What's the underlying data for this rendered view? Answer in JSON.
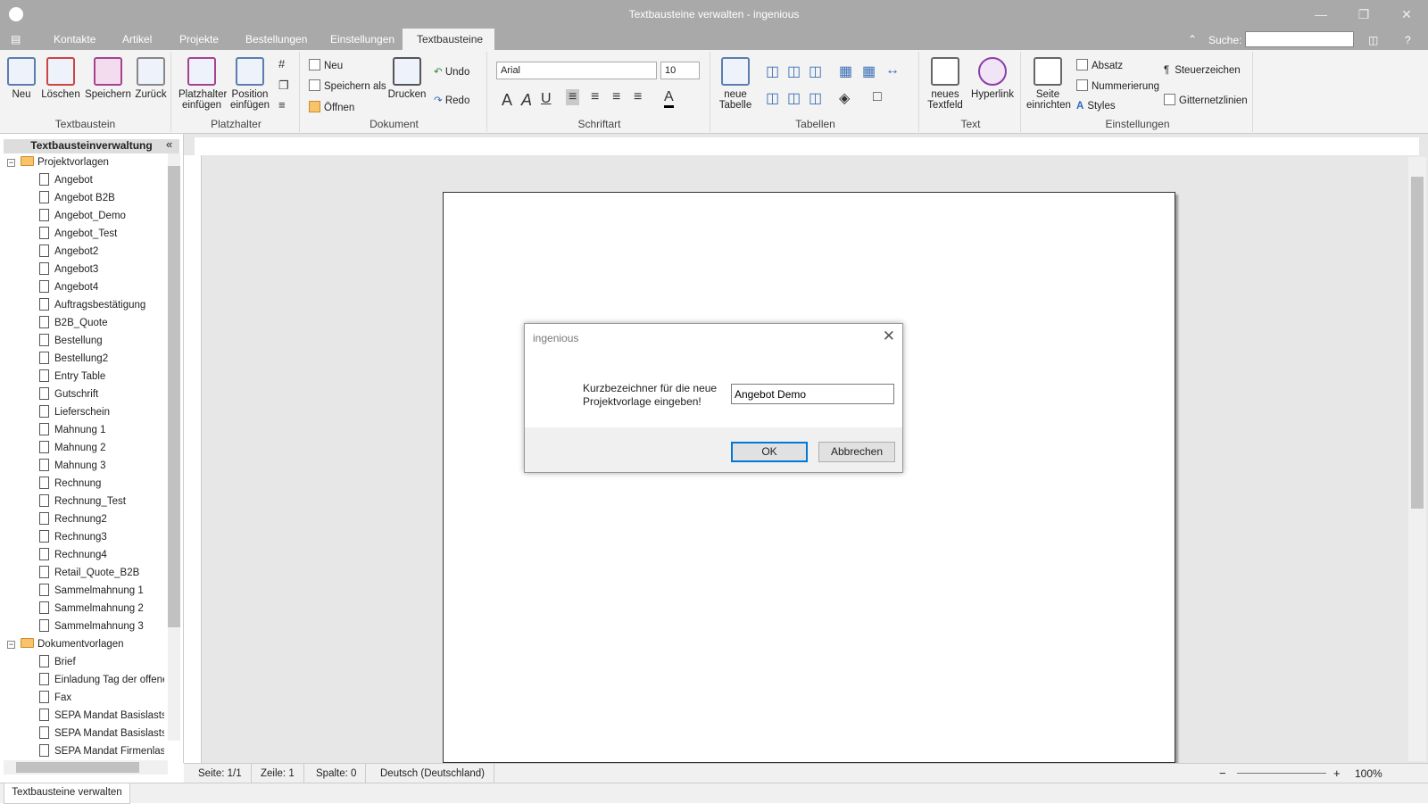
{
  "window": {
    "title": "Textbausteine verwalten - ingenious"
  },
  "menu_tabs": [
    "Kontakte",
    "Artikel",
    "Projekte",
    "Bestellungen",
    "Einstellungen",
    "Textbausteine"
  ],
  "search": {
    "label": "Suche:"
  },
  "ribbon": {
    "textbaustein": {
      "label": "Textbaustein",
      "buttons": [
        "Neu",
        "Löschen",
        "Speichern",
        "Zurück"
      ]
    },
    "platzhalter": {
      "label": "Platzhalter",
      "buttons": [
        "Platzhalter\neinfügen",
        "Position\neinfügen"
      ]
    },
    "dokument": {
      "label": "Dokument",
      "neu": "Neu",
      "speichern_als": "Speichern als",
      "oeffnen": "Öffnen",
      "drucken": "Drucken",
      "undo": "Undo",
      "redo": "Redo"
    },
    "schriftart": {
      "label": "Schriftart",
      "font": "Arial",
      "size": "10"
    },
    "tabellen": {
      "label": "Tabellen",
      "neue_tabelle": "neue\nTabelle"
    },
    "text": {
      "label": "Text",
      "neues_textfeld": "neues\nTextfeld",
      "hyperlink": "Hyperlink"
    },
    "einstellungen": {
      "label": "Einstellungen",
      "seite_einrichten": "Seite\neinrichten",
      "absatz": "Absatz",
      "nummerierung": "Nummerierung",
      "styles": "Styles",
      "steuerzeichen": "Steuerzeichen",
      "gitternetzlinien": "Gitternetzlinien"
    }
  },
  "sidebar": {
    "title": "Textbausteinverwaltung",
    "folders": [
      {
        "name": "Projektvorlagen",
        "items": [
          "Angebot",
          "Angebot B2B",
          "Angebot_Demo",
          "Angebot_Test",
          "Angebot2",
          "Angebot3",
          "Angebot4",
          "Auftragsbestätigung",
          "B2B_Quote",
          "Bestellung",
          "Bestellung2",
          "Entry Table",
          "Gutschrift",
          "Lieferschein",
          "Mahnung 1",
          "Mahnung 2",
          "Mahnung 3",
          "Rechnung",
          "Rechnung_Test",
          "Rechnung2",
          "Rechnung3",
          "Rechnung4",
          "Retail_Quote_B2B",
          "Sammelmahnung 1",
          "Sammelmahnung 2",
          "Sammelmahnung 3"
        ]
      },
      {
        "name": "Dokumentvorlagen",
        "items": [
          "Brief",
          "Einladung Tag der offenen",
          "Fax",
          "SEPA Mandat Basislastsch",
          "SEPA Mandat Basislastsch",
          "SEPA Mandat Firmenlastsc"
        ]
      }
    ]
  },
  "status": {
    "seite": "Seite: 1/1",
    "zeile": "Zeile: 1",
    "spalte": "Spalte: 0",
    "sprache": "Deutsch (Deutschland)",
    "zoom": "100%"
  },
  "bottom_tab": "Textbausteine verwalten",
  "dialog": {
    "title": "ingenious",
    "prompt": "Kurzbezeichner für die neue Projektvorlage eingeben!",
    "value": "Angebot Demo",
    "ok": "OK",
    "cancel": "Abbrechen"
  }
}
